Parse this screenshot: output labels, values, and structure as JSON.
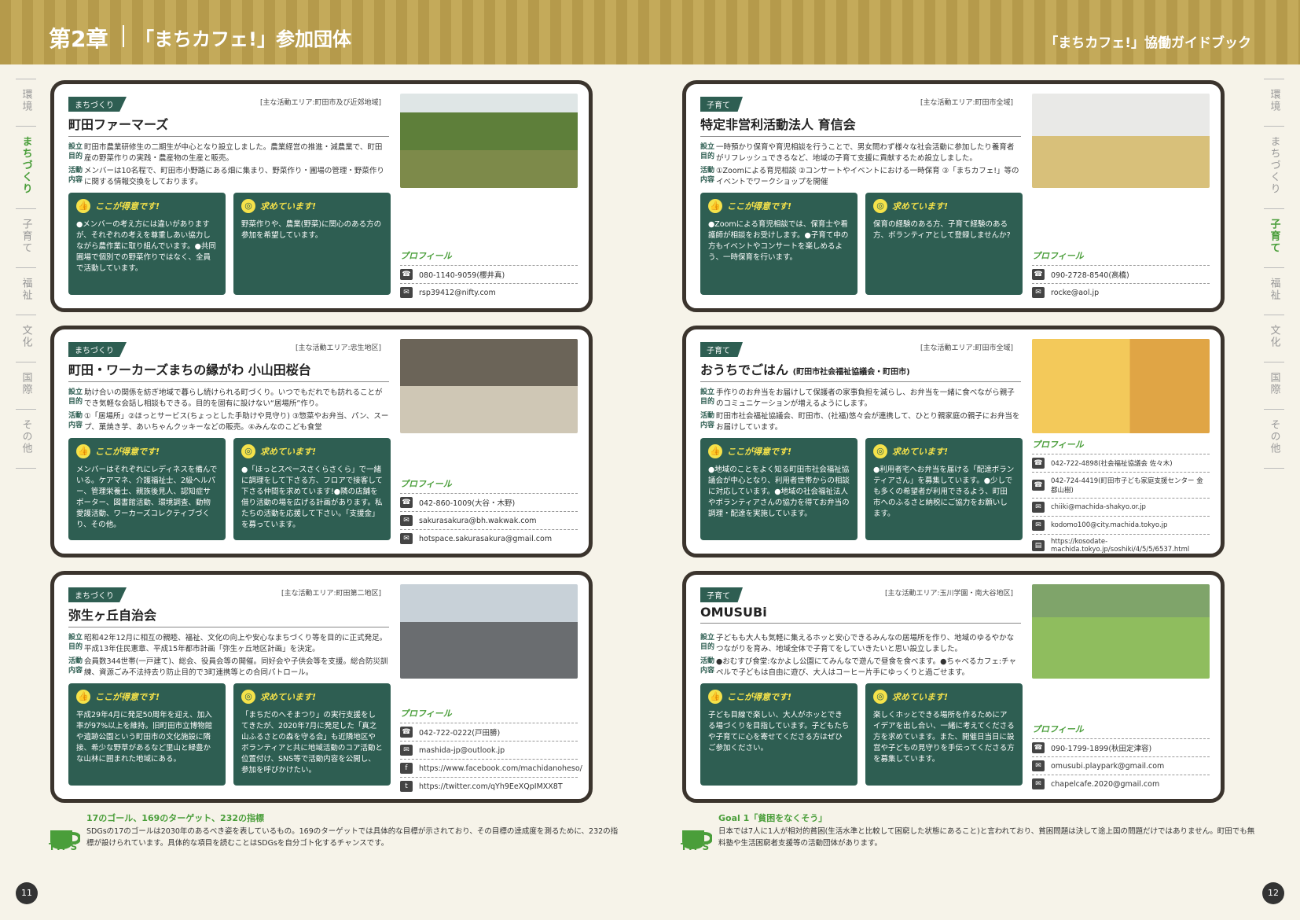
{
  "header": {
    "chapter": "第2章",
    "chapter_title": "「まちカフェ!」参加団体",
    "guide_title": "「まちカフェ!」協働ガイドブック"
  },
  "sidenav_left": [
    "環境",
    "まちづくり",
    "子育て",
    "福祉",
    "文化",
    "国際",
    "その他"
  ],
  "sidenav_right": [
    "環境",
    "まちづくり",
    "子育て",
    "福祉",
    "文化",
    "国際",
    "その他"
  ],
  "labels": {
    "setsuritsu": "設立目的",
    "katsudo": "活動内容",
    "good": "ここが得意です!",
    "want": "求めています!",
    "profile": "プロフィール"
  },
  "cards": [
    {
      "category": "まちづくり",
      "area": "[主な活動エリア:町田市及び近郊地域]",
      "name": "町田ファーマーズ",
      "name_sub": "",
      "purpose": "町田市農業研修生の二期生が中心となり設立しました。農業経営の推進・減農業で、町田産の野菜作りの実践・農産物の生産と販売。",
      "activity": "メンバーは10名程で、町田市小野路にある畑に集まり、野菜作り・圃場の管理・野菜作りに関する情報交換をしております。",
      "good": "●メンバーの考え方には違いがありますが、それぞれの考えを尊重しあい協力しながら農作業に取り組んでいます。●共同圃場で個別での野菜作りではなく、全員で活動しています。",
      "want": "野菜作りや、農業(野菜)に関心のある方の参加を希望しています。",
      "contacts": [
        {
          "icon": "phone-icon",
          "text": "080-1140-9059(櫻井真)"
        },
        {
          "icon": "mail-icon",
          "text": "rsp39412@nifty.com"
        }
      ]
    },
    {
      "category": "子育て",
      "area": "[主な活動エリア:町田市全域]",
      "name": "特定非営利活動法人 育信会",
      "name_sub": "",
      "purpose": "一時預かり保育や育児相談を行うことで、男女問わず様々な社会活動に参加したり養育者がリフレッシュできるなど、地域の子育て支援に貢献するため設立しました。",
      "activity": "①Zoomによる育児相談 ②コンサートやイベントにおける一時保育 ③「まちカフェ!」等のイベントでワークショップを開催",
      "good": "●Zoomによる育児相談では、保育士や看護師が相談をお受けします。●子育て中の方もイベントやコンサートを楽しめるよう、一時保育を行います。",
      "want": "保育の経験のある方、子育て経験のある方、ボランティアとして登録しませんか?",
      "contacts": [
        {
          "icon": "phone-icon",
          "text": "090-2728-8540(高橋)"
        },
        {
          "icon": "mail-icon",
          "text": "rocke@aol.jp"
        }
      ]
    },
    {
      "category": "まちづくり",
      "area": "[主な活動エリア:忠生地区]",
      "name": "町田・ワーカーズまちの縁がわ 小山田桜台",
      "name_sub": "",
      "purpose": "助け合いの関係を紡ぎ地域で暮らし続けられる町づくり。いつでもだれでも訪れることができ気軽な会話し相談もできる。目的を固有に設けない“居場所”作り。",
      "activity": "①「居場所」②ほっとサービス(ちょっとした手助けや見守り) ③惣菜やお弁当、パン、スープ、菓焼き芋、あいちゃんクッキーなどの販売。④みんなのこども食堂",
      "good": "メンバーはそれぞれにレディネスを備んでいる。ケアマネ、介護福祉士、2級ヘルパー、管理栄養士、親族後見人、認知症サポーター、図書館活動、環境調査、動物愛護活動、ワーカーズコレクティブづくり、その他。",
      "want": "●「ほっとスペースさくらさくら」で一緒に調理をして下さる方、フロアで接客して下さる仲間を求めています!●隣の店舗を借り活動の場を広げる計画があります。私たちの活動を応援して下さい。「支援金」を募っています。",
      "contacts": [
        {
          "icon": "phone-icon",
          "text": "042-860-1009(大谷・木野)"
        },
        {
          "icon": "mail-icon",
          "text": "sakurasakura@bh.wakwak.com"
        },
        {
          "icon": "mail-icon",
          "text": "hotspace.sakurasakura@gmail.com"
        }
      ]
    },
    {
      "category": "子育て",
      "area": "[主な活動エリア:町田市全域]",
      "name": "おうちでごはん",
      "name_sub": "(町田市社会福祉協議会・町田市)",
      "purpose": "手作りのお弁当をお届けして保護者の家事負担を減らし、お弁当を一緒に食べながら親子のコミュニケーションが増えるようにします。",
      "activity": "町田市社会福祉協議会、町田市、(社福)悠々会が連携して、ひとり親家庭の親子にお弁当をお届けしています。",
      "good": "●地域のことをよく知る町田市社会福祉協議会が中心となり、利用者世帯からの相談に対応しています。●地域の社会福祉法人やボランティアさんの協力を得てお弁当の調理・配達を実施しています。",
      "want": "●利用者宅へお弁当を届ける「配達ボランティアさん」を募集しています。●少しでも多くの希望者が利用できるよう、町田市へのふるさと納税にご協力をお願いします。",
      "contacts": [
        {
          "icon": "phone-icon",
          "text": "042-722-4898(社会福祉協議会 佐々木)"
        },
        {
          "icon": "phone-icon",
          "text": "042-724-4419(町田市子ども家庭支援センター 金都山樹)"
        },
        {
          "icon": "mail-icon",
          "text": "chiiki@machida-shakyo.or.jp"
        },
        {
          "icon": "mail-icon",
          "text": "kodomo100@city.machida.tokyo.jp"
        },
        {
          "icon": "web-icon",
          "text": "https://kosodate-machida.tokyo.jp/soshiki/4/5/5/6537.html"
        }
      ]
    },
    {
      "category": "まちづくり",
      "area": "[主な活動エリア:町田第二地区]",
      "name": "弥生ヶ丘自治会",
      "name_sub": "",
      "purpose": "昭和42年12月に相互の親睦、福祉、文化の向上や安心なまちづくり等を目的に正式発足。平成13年住民憲章、平成15年都市計画「弥生ヶ丘地区計画」を決定。",
      "activity": "会員数344世帯(一戸建て)、総会、役員会等の開催。同好会や子供会等を支援。総合防災訓練、資源ごみ不法持去り防止目的で3町連携等との合同パトロール。",
      "good": "平成29年4月に発足50周年を迎え、加入率が97%以上を維持。旧町田市立博物館や遺跡公園という町田市の文化施設に隣接、希少な野草があるなど里山と緑豊かな山林に囲まれた地域にある。",
      "want": "「まちだのへそまつり」の実行支援をしてきたが、2020年7月に発足した「真之山ふるさとの森を守る会」も近隣地区やボランティアと共に地域活動のコア活動と位置付け、SNS等で活動内容を公開し、参加を呼びかけたい。",
      "contacts": [
        {
          "icon": "phone-icon",
          "text": "042-722-0222(戸田勝)"
        },
        {
          "icon": "mail-icon",
          "text": "mashida-jp@outlook.jp"
        },
        {
          "icon": "facebook-icon",
          "text": "https://www.facebook.com/machidanoheso/"
        },
        {
          "icon": "twitter-icon",
          "text": "https://twitter.com/qYh9EeXQpIMXX8T"
        }
      ]
    },
    {
      "category": "子育て",
      "area": "[主な活動エリア:玉川学園・南大谷地区]",
      "name": "OMUSUBi",
      "name_sub": "",
      "purpose": "子どもも大人も気軽に集えるホッと安心できるみんなの居場所を作り、地域のゆるやかなつながりを育み、地域全体で子育てをしていきたいと思い設立しました。",
      "activity": "●おむすび食堂:なかよし公園にてみんなで遊んで昼食を食べます。●ちゃべるカフェ:チャペルで子どもは自由に遊び、大人はコーヒー片手にゆっくりと過ごせます。",
      "good": "子ども目線で楽しい、大人がホッとできる場づくりを目指しています。子どもたちや子育てに心を寄せてくださる方はぜひご参加ください。",
      "want": "楽しくホッとできる場所を作るためにアイデアを出し合い、一緒に考えてくださる方を求めています。また、開催日当日に設営や子どもの見守りを手伝ってくださる方を募集しています。",
      "contacts": [
        {
          "icon": "phone-icon",
          "text": "090-1799-1899(秋田定津容)"
        },
        {
          "icon": "mail-icon",
          "text": "omusubi.playpark@gmail.com"
        },
        {
          "icon": "mail-icon",
          "text": "chapelcafe.2020@gmail.com"
        }
      ]
    }
  ],
  "tips_left": {
    "label": "TIPS",
    "head": "17のゴール、169のターゲット、232の指標",
    "body": "SDGsの17のゴールは2030年のあるべき姿を表しているもの。169のターゲットでは具体的な目標が示されており、その目標の達成度を測るために、232の指標が設けられています。具体的な項目を読むことはSDGsを自分ゴト化するチャンスです。"
  },
  "tips_right": {
    "label": "TIPS",
    "head": "Goal 1「貧困をなくそう」",
    "body": "日本では7人に1人が相対的貧困(生活水準と比較して困窮した状態にあること)と言われており、貧困問題は決して途上国の問題だけではありません。町田でも無料塾や生活困窮者支援等の活動団体があります。"
  },
  "page_left": "11",
  "page_right": "12",
  "colors": {
    "header": "#b59a4b",
    "card_border": "#3b342d",
    "box": "#2e5e52",
    "accent_yellow": "#f5e24a",
    "accent_green": "#4a9e3a"
  }
}
